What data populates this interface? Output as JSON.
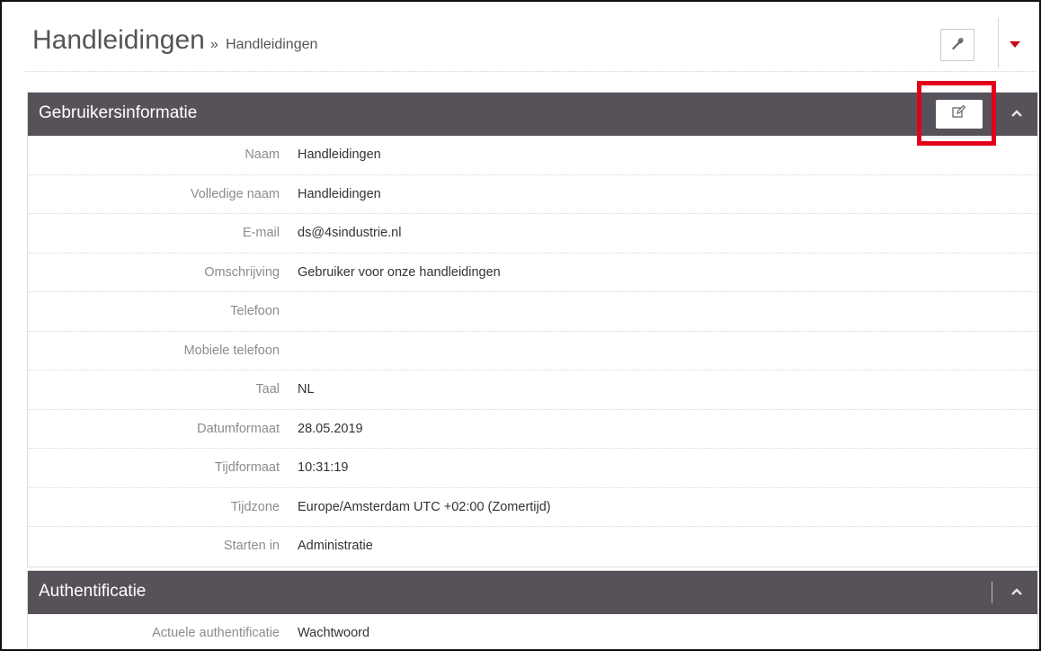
{
  "header": {
    "title": "Handleidingen",
    "separator": "»",
    "breadcrumb": "Handleidingen",
    "tool_icon": "wrench-icon",
    "menu_icon": "caret-down-icon",
    "accent_color": "#d0021b"
  },
  "panels": {
    "user_info": {
      "title": "Gebruikersinformatie",
      "edit_icon": "edit-icon",
      "collapse_icon": "chevron-up-icon",
      "highlight_color": "#e3001b",
      "header_color": "#57525a",
      "rows": [
        {
          "label": "Naam",
          "value": "Handleidingen"
        },
        {
          "label": "Volledige naam",
          "value": "Handleidingen"
        },
        {
          "label": "E-mail",
          "value": "ds@4sindustrie.nl"
        },
        {
          "label": "Omschrijving",
          "value": "Gebruiker voor onze handleidingen"
        },
        {
          "label": "Telefoon",
          "value": ""
        },
        {
          "label": "Mobiele telefoon",
          "value": ""
        },
        {
          "label": "Taal",
          "value": "NL"
        },
        {
          "label": "Datumformaat",
          "value": "28.05.2019"
        },
        {
          "label": "Tijdformaat",
          "value": "10:31:19"
        },
        {
          "label": "Tijdzone",
          "value": "Europe/Amsterdam UTC +02:00 (Zomertijd)"
        },
        {
          "label": "Starten in",
          "value": "Administratie"
        }
      ]
    },
    "auth": {
      "title": "Authentificatie",
      "collapse_icon": "chevron-up-icon",
      "rows": [
        {
          "label": "Actuele authentificatie",
          "value": "Wachtwoord"
        }
      ]
    }
  }
}
